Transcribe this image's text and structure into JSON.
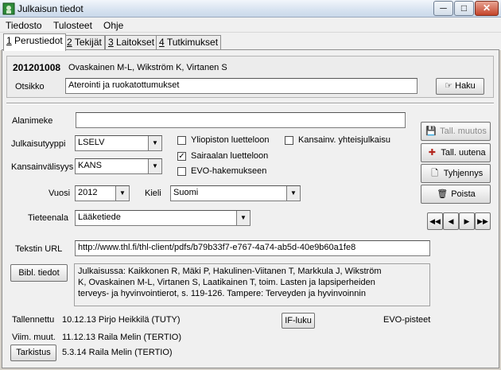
{
  "window": {
    "title": "Julkaisun tiedot",
    "minimize": "─",
    "maximize": "□",
    "close": "✕"
  },
  "menu": [
    "Tiedosto",
    "Tulosteet",
    "Ohje"
  ],
  "tabs": [
    {
      "num": "1",
      "label": "Perustiedot"
    },
    {
      "num": "2",
      "label": "Tekijät"
    },
    {
      "num": "3",
      "label": "Laitokset"
    },
    {
      "num": "4",
      "label": "Tutkimukset"
    }
  ],
  "header": {
    "id": "201201008",
    "authors": "Ovaskainen M-L, Wikström K, Virtanen S",
    "title_label": "Otsikko",
    "title_value": "Aterointi ja ruokatottumukset",
    "search_button": "Haku"
  },
  "form": {
    "subtitle_label": "Alanimeke",
    "subtitle_value": "",
    "type_label": "Julkaisutyyppi",
    "type_value": "LSELV",
    "intl_label": "Kansainvälisyys",
    "intl_value": "KANS",
    "year_label": "Vuosi",
    "year_value": "2012",
    "lang_label": "Kieli",
    "lang_value": "Suomi",
    "field_label": "Tieteenala",
    "field_value": "Lääketiede",
    "url_label": "Tekstin URL",
    "url_value": "http://www.thl.fi/thl-client/pdfs/b79b33f7-e767-4a74-ab5d-40e9b60a1fe8",
    "bibl_button": "Bibl. tiedot",
    "bibl_lines": [
      "Julkaisussa: Kaikkonen R, Mäki P, Hakulinen-Viitanen T, Markkula J, Wikström",
      "K, Ovaskainen M-L, Virtanen S, Laatikainen T, toim. Lasten ja lapsiperheiden",
      "terveys- ja hyvinvointierot, s. 119-126. Tampere: Terveyden ja hyvinvoinnin"
    ]
  },
  "checks": {
    "university": {
      "label": "Yliopiston luetteloon",
      "checked": false
    },
    "hospital": {
      "label": "Sairaalan luetteloon",
      "checked": true
    },
    "evo": {
      "label": "EVO-hakemukseen",
      "checked": false
    },
    "international": {
      "label": "Kansainv. yhteisjulkaisu",
      "checked": false
    }
  },
  "side_buttons": {
    "save_changes": "Tall. muutos",
    "save_new": "Tall. uutena",
    "clear": "Tyhjennys",
    "delete": "Poista"
  },
  "nav": {
    "first": "◀◀",
    "prev": "◀",
    "next": "▶",
    "last": "▶▶"
  },
  "footer": {
    "saved_label": "Tallennettu",
    "saved_value": "10.12.13 Pirjo Heikkilä (TUTY)",
    "modified_label": "Viim. muut.",
    "modified_value": "11.12.13 Raila Melin (TERTIO)",
    "check_button": "Tarkistus",
    "check_value": "5.3.14 Raila Melin (TERTIO)",
    "if_button": "IF-luku",
    "evo_label": "EVO-pisteet"
  },
  "colors": {
    "accent": "#2f5f9e",
    "panel": "#f0f0f0",
    "frame": "#d4d0c8"
  }
}
